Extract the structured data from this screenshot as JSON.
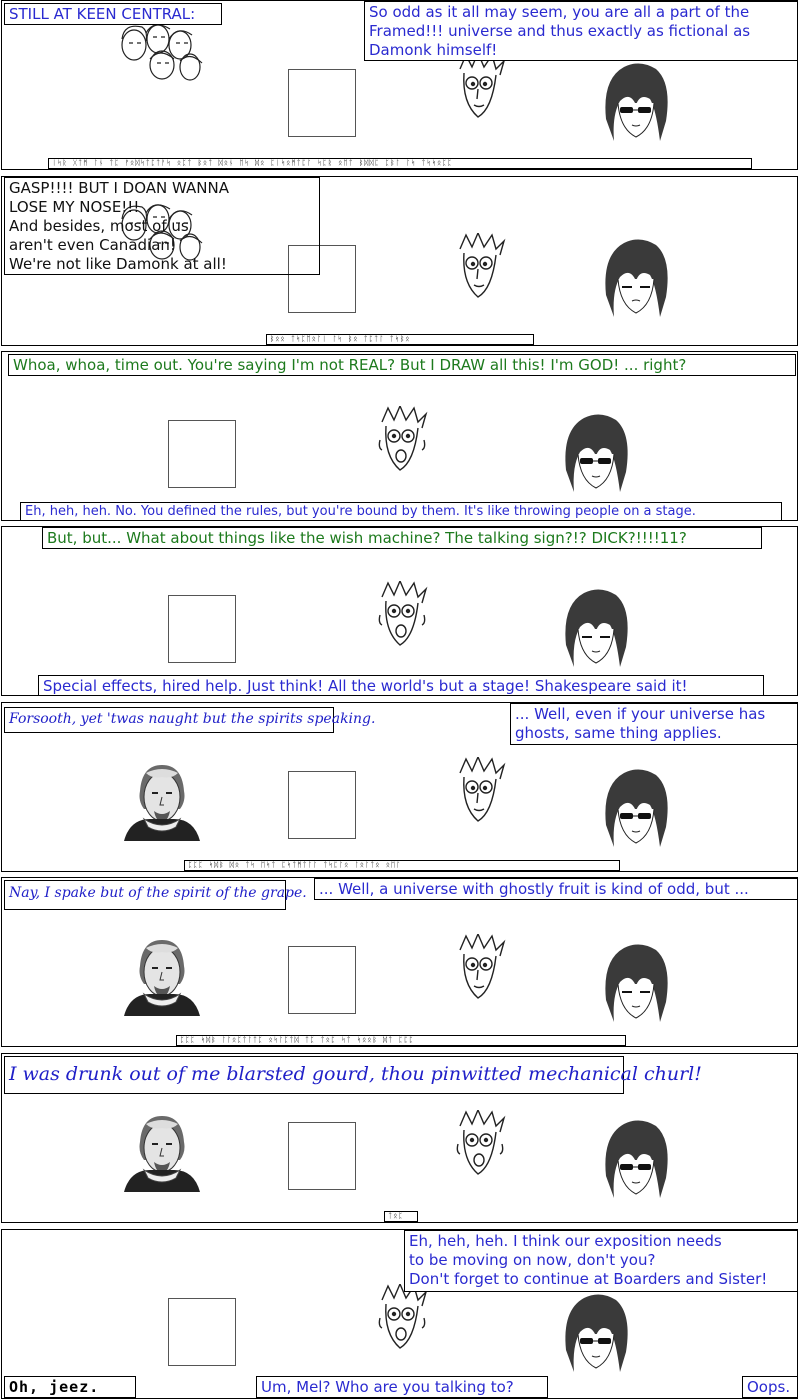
{
  "panels": [
    {
      "captions": {
        "label": "STILL AT KEEN CENTRAL:",
        "mel": "So odd as it all may seem, you are all a part of the Framed!!! universe and thus exactly as fictional as Damonk himself!",
        "glyphs": "ᛁᛋᚱ ᚷᛏᛗ ᛚᚾ ᛏᛈ ᚠᛟᛞᛋᛏᛈᛏᚨᛋ ᛟᛈᛏ ᛒᛟᛏ ᛞᛟᚾ ᛖᛋ ᛞᛟ ᛈᛁᛋᛟᛗᛏᛈᛚ ᛋᛈᚱ ᛟᛖᛏ ᛒᛞᛞᛈ ᛈᛒᛚ ᛚᛋ ᛏᛋᛋᛟᛈᛈ"
      }
    },
    {
      "captions": {
        "group": "GASP!!!!  BUT I DOAN WANNA\nLOSE MY                         NOSE!!!\nAnd besides,                    most of us\naren't even                    Canadian!\nWe're not like Damonk at all!",
        "glyphs": "ᛒᛟᛟ ᛏᛋᛈᛖᛟᛚᛁ ᛚᛋ ᛒᛟ ᛏᛈᛏᛚ ᛏᛋᛒᛟ"
      }
    },
    {
      "captions": {
        "author": "Whoa, whoa, time out.  You're saying I'm not REAL?  But I DRAW all this!  I'm GOD!  ...   right?",
        "mel": "Eh, heh, heh.  No.  You defined the rules, but you're bound by them.  It's like throwing people on a stage."
      }
    },
    {
      "captions": {
        "author": "But, but... What about things like the wish machine?  The talking sign?!?  DICK?!!!!11?",
        "mel": "Special effects, hired help.  Just think!  All the world's but a stage!  Shakespeare said it!"
      }
    },
    {
      "captions": {
        "shakespeare": "Forsooth, yet 'twas naught but the spirits speaking.",
        "mel": "...  Well, even if your universe has ghosts, same thing applies.",
        "glyphs": "ᛈᛈᛈ ᛋᛞᛒ ᛞᛟ ᛏᛋ ᛖᛋᛏ ᛈᛋᛏᛗᛏᛚᛚ ᛏᛋᛈᛚᛟ ᛚᛟᛚᛏᛟ ᛟᛖᛚ"
      }
    },
    {
      "captions": {
        "shakespeare": "Nay, I spake but of the spirit of the grape.",
        "mel": "...  Well, a universe with ghostly fruit is kind of odd, but ...",
        "glyphs": "ᛈᛈᛈ ᛋᛞᛒ ᛚᛚᛟᛈᛏᛚᛏᛈ ᛟᛋᛚᛈᛏᛞ ᛏᛈ ᛏᛟᛈ ᛋᛏ ᛋᛟᛟᛒ ᛞᛏ ᛈᛈᛈ"
      }
    },
    {
      "captions": {
        "shakespeare": "I was drunk out of me blarsted gourd, thou pinwitted mechanical churl!",
        "glyphs": "ᛏᛟᛈ"
      }
    },
    {
      "captions": {
        "mel": "Eh, heh, heh.  I think our exposition needs\nto be moving on now, don't you?\nDon't forget to continue at Boarders and Sister!",
        "sign": "Oh, jeez.",
        "author": "Um, Mel?  Who are you talking to?",
        "mel_end": "Oops."
      }
    }
  ]
}
